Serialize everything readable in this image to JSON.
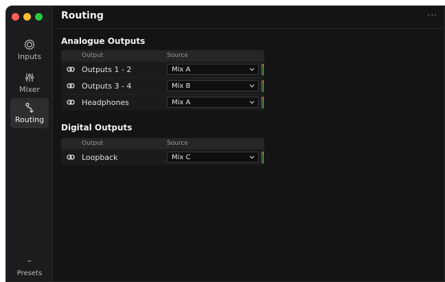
{
  "window": {
    "title": "Routing",
    "more_label": "···",
    "traffic_colors": [
      "#ff5f57",
      "#febc2e",
      "#28c840"
    ]
  },
  "sidebar": {
    "items": [
      {
        "label": "Inputs",
        "icon": "inputs-icon"
      },
      {
        "label": "Mixer",
        "icon": "mixer-icon"
      },
      {
        "label": "Routing",
        "icon": "routing-icon",
        "active": true
      }
    ],
    "presets_dash": "–",
    "presets_label": "Presets"
  },
  "analogue": {
    "title": "Analogue Outputs",
    "col_output": "Output",
    "col_source": "Source",
    "rows": [
      {
        "name": "Outputs 1 - 2",
        "source": "Mix A"
      },
      {
        "name": "Outputs 3 - 4",
        "source": "Mix B"
      },
      {
        "name": "Headphones",
        "source": "Mix A"
      }
    ]
  },
  "digital": {
    "title": "Digital Outputs",
    "col_output": "Output",
    "col_source": "Source",
    "rows": [
      {
        "name": "Loopback",
        "source": "Mix C"
      }
    ]
  }
}
